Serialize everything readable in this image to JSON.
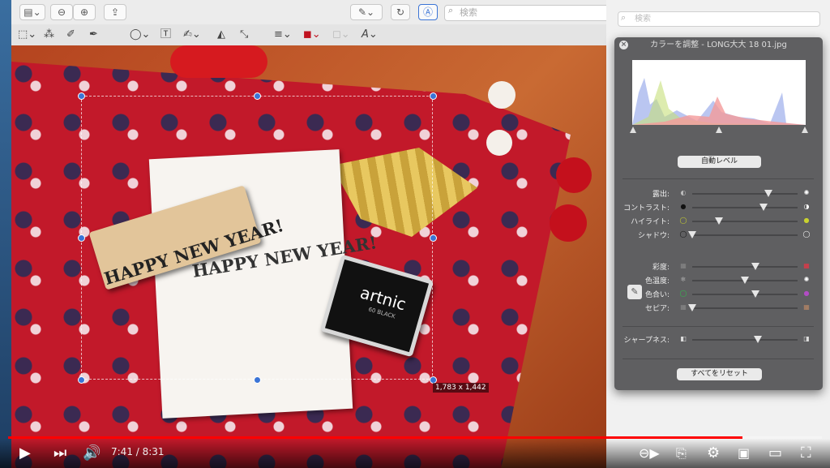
{
  "toolbar": {
    "search_placeholder": "検索",
    "sidebar_icon": "sidebar-icon",
    "zoom_out_icon": "zoom-out-icon",
    "zoom_in_icon": "zoom-in-icon",
    "share_icon": "share-icon"
  },
  "photo": {
    "paper_text": "HAPPY NEW YEAR!",
    "stamp_text": "HAPPY NEW YEAR!",
    "inkpad_brand": "artnic",
    "inkpad_sub": "60 BLACK",
    "selection_size": "1,783 x 1,442"
  },
  "finder": {
    "search_placeholder": "検索"
  },
  "panel": {
    "title": "カラーを調整 - LONG大大 18 01.jpg",
    "auto_levels": "自動レベル",
    "reset_all": "すべてをリセット",
    "rows": [
      {
        "label": "露出:",
        "value": 0.72
      },
      {
        "label": "コントラスト:",
        "value": 0.68
      },
      {
        "label": "ハイライト:",
        "value": 0.25
      },
      {
        "label": "シャドウ:",
        "value": 0.0
      },
      {
        "label": "彩度:",
        "value": 0.6
      },
      {
        "label": "色温度:",
        "value": 0.5
      },
      {
        "label": "色合い:",
        "value": 0.6
      },
      {
        "label": "セピア:",
        "value": 0.0
      },
      {
        "label": "シャープネス:",
        "value": 0.62
      }
    ]
  },
  "video": {
    "time": "7:41 / 8:31",
    "progress": 0.902,
    "accent": "#ff0000"
  }
}
